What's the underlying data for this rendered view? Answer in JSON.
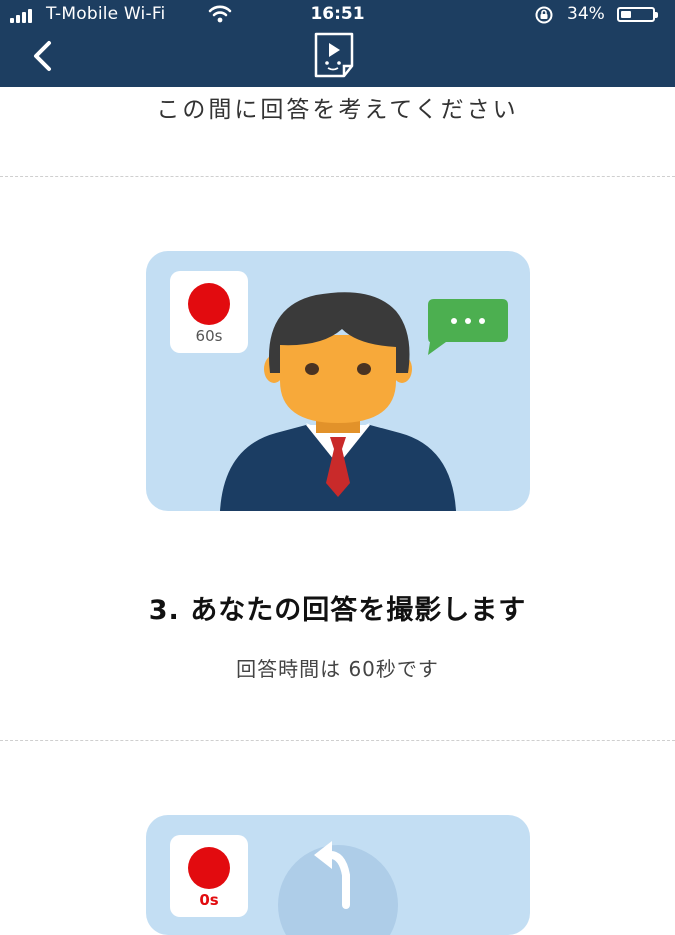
{
  "status_bar": {
    "carrier": "T-Mobile Wi-Fi",
    "time": "16:51",
    "battery_percent": "34%",
    "battery_level": 0.34
  },
  "nav": {
    "back_icon": "chevron-left-icon",
    "logo_icon": "video-document-logo-icon"
  },
  "prompt_text": "この間に回答を考えてください",
  "step3": {
    "title": "3. あなたの回答を撮影します",
    "subtitle": "回答時間は 60秒です",
    "timer_label": "60s"
  },
  "step4_preview": {
    "timer_label": "0s"
  },
  "colors": {
    "header": "#1d3e61",
    "card_bg": "#c3def3",
    "record_red": "#e20b0f",
    "chat_green": "#4caf50",
    "suit": "#1b3d63",
    "tie": "#c92a2a",
    "skin": "#f7a93a",
    "hair": "#3a3a3a"
  }
}
